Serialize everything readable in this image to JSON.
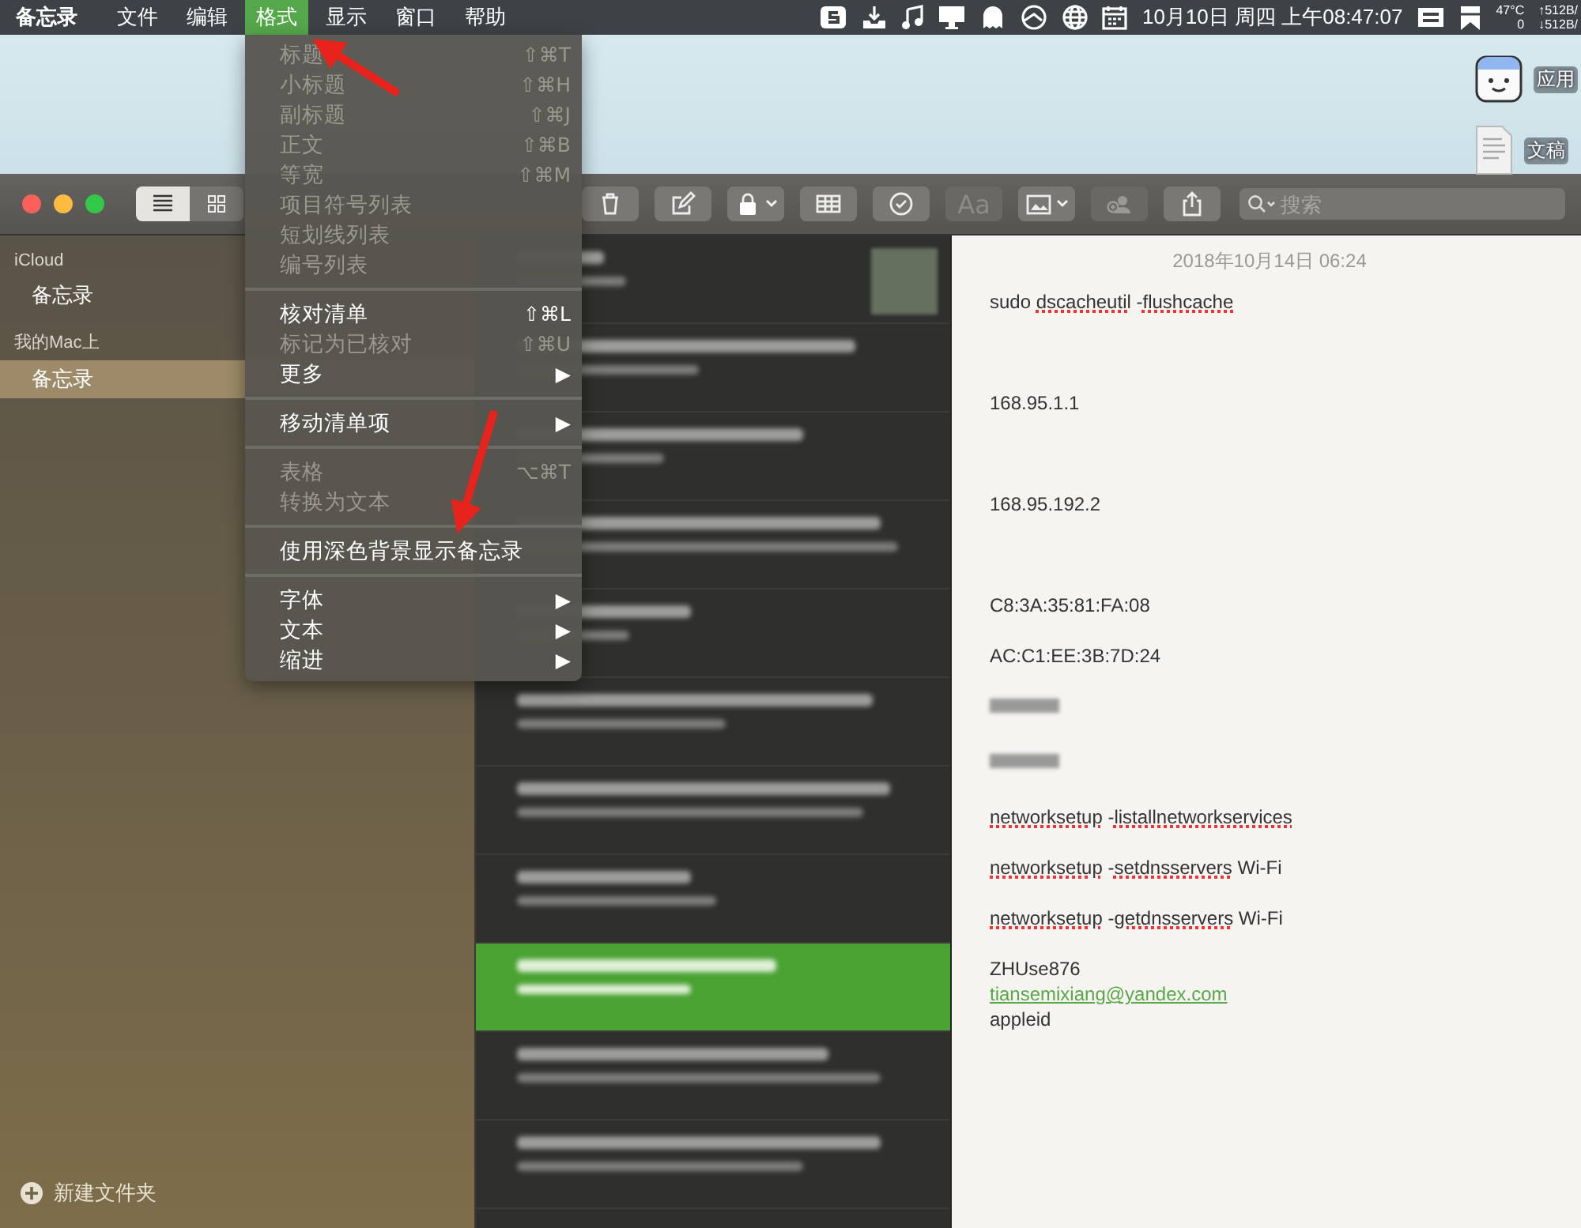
{
  "menu_bar": {
    "app": "备忘录",
    "menus": [
      {
        "label": "文件",
        "selected": false
      },
      {
        "label": "编辑",
        "selected": false
      },
      {
        "label": "格式",
        "selected": true
      },
      {
        "label": "显示",
        "selected": false
      },
      {
        "label": "窗口",
        "selected": false
      },
      {
        "label": "帮助",
        "selected": false
      }
    ],
    "clock": "10月10日 周四 上午08:47:07",
    "temperature": "47°C",
    "fan": "0",
    "upload": "↑512B/",
    "download": "↓512B/"
  },
  "desktop_icons": [
    {
      "kind": "app",
      "label": "应用"
    },
    {
      "kind": "document",
      "label": "文稿"
    }
  ],
  "toolbar": {
    "view_modes": [
      {
        "kind": "list",
        "selected": true
      },
      {
        "kind": "grid",
        "selected": false
      }
    ],
    "buttons": [
      {
        "kind": "delete",
        "disabled": false,
        "dropdown": false
      },
      {
        "kind": "compose",
        "disabled": false,
        "dropdown": false
      },
      {
        "kind": "lock",
        "disabled": false,
        "dropdown": true
      },
      {
        "kind": "table",
        "disabled": false,
        "dropdown": false
      },
      {
        "kind": "checklist",
        "disabled": false,
        "dropdown": false
      },
      {
        "kind": "format",
        "disabled": true,
        "dropdown": false,
        "label": "Aa"
      },
      {
        "kind": "media",
        "disabled": false,
        "dropdown": true
      },
      {
        "kind": "share_people",
        "disabled": true,
        "dropdown": false
      },
      {
        "kind": "share",
        "disabled": false,
        "dropdown": false
      }
    ],
    "search": {
      "placeholder": "搜索"
    }
  },
  "format_menu": [
    {
      "kind": "item",
      "label": "标题",
      "shortcut": "⇧⌘T",
      "disabled": true
    },
    {
      "kind": "item",
      "label": "小标题",
      "shortcut": "⇧⌘H",
      "disabled": true
    },
    {
      "kind": "item",
      "label": "副标题",
      "shortcut": "⇧⌘J",
      "disabled": true
    },
    {
      "kind": "item",
      "label": "正文",
      "shortcut": "⇧⌘B",
      "disabled": true
    },
    {
      "kind": "item",
      "label": "等宽",
      "shortcut": "⇧⌘M",
      "disabled": true
    },
    {
      "kind": "item",
      "label": "项目符号列表",
      "disabled": true
    },
    {
      "kind": "item",
      "label": "短划线列表",
      "disabled": true
    },
    {
      "kind": "item",
      "label": "编号列表",
      "disabled": true
    },
    {
      "kind": "separator"
    },
    {
      "kind": "item",
      "label": "核对清单",
      "shortcut": "⇧⌘L",
      "disabled": false
    },
    {
      "kind": "item",
      "label": "标记为已核对",
      "shortcut": "⇧⌘U",
      "disabled": true
    },
    {
      "kind": "item",
      "label": "更多",
      "arrow": "▶",
      "disabled": false
    },
    {
      "kind": "separator"
    },
    {
      "kind": "item",
      "label": "移动清单项",
      "arrow": "▶",
      "disabled": false
    },
    {
      "kind": "separator"
    },
    {
      "kind": "item",
      "label": "表格",
      "shortcut": "⌥⌘T",
      "disabled": true
    },
    {
      "kind": "item",
      "label": "转换为文本",
      "disabled": true
    },
    {
      "kind": "separator"
    },
    {
      "kind": "item",
      "label": "使用深色背景显示备忘录",
      "disabled": false
    },
    {
      "kind": "separator"
    },
    {
      "kind": "item",
      "label": "字体",
      "arrow": "▶",
      "disabled": false
    },
    {
      "kind": "item",
      "label": "文本",
      "arrow": "▶",
      "disabled": false
    },
    {
      "kind": "item",
      "label": "缩进",
      "arrow": "▶",
      "disabled": false
    }
  ],
  "sidebar": {
    "sections": [
      {
        "title": "iCloud",
        "items": [
          {
            "label": "备忘录",
            "selected": false
          }
        ]
      },
      {
        "title": "我的Mac上",
        "items": [
          {
            "label": "备忘录",
            "selected": true
          }
        ]
      }
    ],
    "new_folder": "新建文件夹"
  },
  "note_list": [
    {
      "selected": false,
      "thumbnail": true
    },
    {
      "selected": false,
      "thumbnail": false
    },
    {
      "selected": false,
      "thumbnail": false
    },
    {
      "selected": false,
      "thumbnail": false
    },
    {
      "selected": false,
      "thumbnail": false
    },
    {
      "selected": false,
      "thumbnail": false
    },
    {
      "selected": false,
      "thumbnail": false
    },
    {
      "selected": false,
      "thumbnail": false
    },
    {
      "selected": true,
      "thumbnail": false
    },
    {
      "selected": false,
      "thumbnail": false
    },
    {
      "selected": false,
      "thumbnail": false
    }
  ],
  "note": {
    "date": "2018年10月14日 06:24",
    "lines": [
      {
        "kind": "text",
        "segments": [
          {
            "text": "sudo ",
            "misspelled": false
          },
          {
            "text": "dscacheutil",
            "misspelled": true
          },
          {
            "text": " -",
            "misspelled": false
          },
          {
            "text": "flushcache",
            "misspelled": true
          }
        ]
      },
      {
        "kind": "blank"
      },
      {
        "kind": "blank"
      },
      {
        "kind": "blank"
      },
      {
        "kind": "text",
        "segments": [
          {
            "text": "168.95.1.1",
            "misspelled": false
          }
        ]
      },
      {
        "kind": "blank"
      },
      {
        "kind": "blank"
      },
      {
        "kind": "blank"
      },
      {
        "kind": "text",
        "segments": [
          {
            "text": "168.95.192.2",
            "misspelled": false
          }
        ]
      },
      {
        "kind": "blank"
      },
      {
        "kind": "blank"
      },
      {
        "kind": "blank"
      },
      {
        "kind": "text",
        "segments": [
          {
            "text": "C8:3A:35:81:FA:08",
            "misspelled": false
          }
        ]
      },
      {
        "kind": "blank"
      },
      {
        "kind": "text",
        "segments": [
          {
            "text": "AC:C1:EE:3B:7D:24",
            "misspelled": false
          }
        ]
      },
      {
        "kind": "blank"
      },
      {
        "kind": "redacted"
      },
      {
        "kind": "blank"
      },
      {
        "kind": "redacted"
      },
      {
        "kind": "blank"
      },
      {
        "kind": "text",
        "segments": [
          {
            "text": "networksetup",
            "misspelled": true
          },
          {
            "text": " -",
            "misspelled": false
          },
          {
            "text": "listallnetworkservices",
            "misspelled": true
          }
        ]
      },
      {
        "kind": "blank"
      },
      {
        "kind": "text",
        "segments": [
          {
            "text": "networksetup",
            "misspelled": true
          },
          {
            "text": " -",
            "misspelled": false
          },
          {
            "text": "setdnsservers",
            "misspelled": true
          },
          {
            "text": " Wi-Fi",
            "misspelled": false
          }
        ]
      },
      {
        "kind": "blank"
      },
      {
        "kind": "text",
        "segments": [
          {
            "text": "networksetup",
            "misspelled": true
          },
          {
            "text": " -",
            "misspelled": false
          },
          {
            "text": "getdnsservers",
            "misspelled": true
          },
          {
            "text": " Wi-Fi",
            "misspelled": false
          }
        ]
      },
      {
        "kind": "blank"
      },
      {
        "kind": "text",
        "segments": [
          {
            "text": "ZHUse876",
            "misspelled": false
          }
        ]
      },
      {
        "kind": "link",
        "segments": [
          {
            "text": "tiansemixiang@yandex.com",
            "misspelled": false
          }
        ]
      },
      {
        "kind": "text",
        "segments": [
          {
            "text": "appleid",
            "misspelled": false
          }
        ]
      }
    ]
  }
}
